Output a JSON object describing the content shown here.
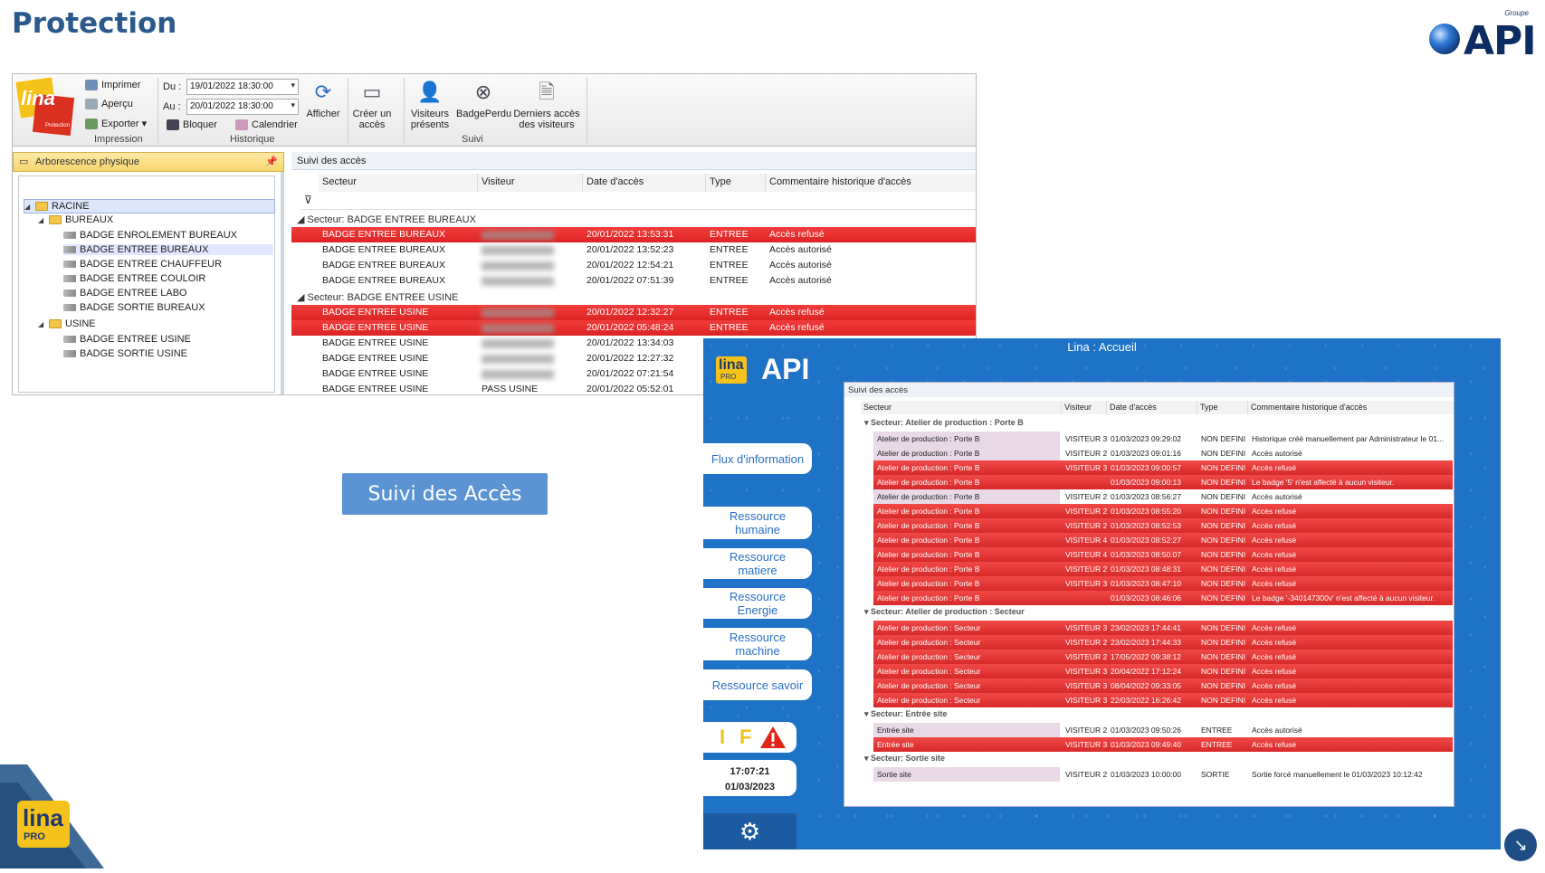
{
  "slide": {
    "title": "Protection",
    "brand_group": "Groupe",
    "brand": "API",
    "center_button": "Suivi des Accès",
    "corner_logo": "lina",
    "corner_logo_sub": "PRO"
  },
  "app1": {
    "ribbon": {
      "print": "Imprimer",
      "preview": "Aperçu",
      "export": "Exporter",
      "group_print": "Impression",
      "from_label": "Du :",
      "from_value": "19/01/2022 18:30:00",
      "to_label": "Au :",
      "to_value": "20/01/2022 18:30:00",
      "block": "Bloquer",
      "calendar": "Calendrier",
      "group_history": "Historique",
      "show": "Afficher",
      "create_access": "Créer un accès",
      "present_visitors": "Visiteurs présents",
      "lost_badge": "BadgePerdu",
      "last_access": "Derniers accès des visiteurs",
      "group_follow": "Suivi",
      "logo": "lina",
      "logo_sub": "Protection"
    },
    "tree": {
      "header": "Arborescence physique",
      "root": "RACINE",
      "folder1": "BUREAUX",
      "folder1_items": [
        "BADGE ENROLEMENT BUREAUX",
        "BADGE ENTREE BUREAUX",
        "BADGE ENTREE CHAUFFEUR",
        "BADGE ENTREE COULOIR",
        "BADGE ENTREE LABO",
        "BADGE SORTIE BUREAUX"
      ],
      "folder2": "USINE",
      "folder2_items": [
        "BADGE ENTREE USINE",
        "BADGE SORTIE USINE"
      ]
    },
    "grid": {
      "header": "Suivi des accès",
      "columns": [
        "Secteur",
        "Visiteur",
        "Date d'accès",
        "Type",
        "Commentaire historique d'accès"
      ],
      "group1": "Secteur: BADGE ENTREE BUREAUX",
      "group1_rows": [
        {
          "sector": "BADGE ENTREE BUREAUX",
          "visitor": "",
          "date": "20/01/2022 13:53:31",
          "type": "ENTREE",
          "comment": "Accès refusé",
          "denied": true
        },
        {
          "sector": "BADGE ENTREE BUREAUX",
          "visitor": "",
          "date": "20/01/2022 13:52:23",
          "type": "ENTREE",
          "comment": "Accès autorisé",
          "denied": false
        },
        {
          "sector": "BADGE ENTREE BUREAUX",
          "visitor": "",
          "date": "20/01/2022 12:54:21",
          "type": "ENTREE",
          "comment": "Accès autorisé",
          "denied": false
        },
        {
          "sector": "BADGE ENTREE BUREAUX",
          "visitor": "",
          "date": "20/01/2022 07:51:39",
          "type": "ENTREE",
          "comment": "Accès autorisé",
          "denied": false
        }
      ],
      "group2": "Secteur: BADGE ENTREE USINE",
      "group2_rows": [
        {
          "sector": "BADGE ENTREE USINE",
          "visitor": "",
          "date": "20/01/2022 12:32:27",
          "type": "ENTREE",
          "comment": "Accès refusé",
          "denied": true
        },
        {
          "sector": "BADGE ENTREE USINE",
          "visitor": "",
          "date": "20/01/2022 05:48:24",
          "type": "ENTREE",
          "comment": "Accès refusé",
          "denied": true
        },
        {
          "sector": "BADGE ENTREE USINE",
          "visitor": "",
          "date": "20/01/2022 13:34:03",
          "type": "",
          "comment": "",
          "denied": false
        },
        {
          "sector": "BADGE ENTREE USINE",
          "visitor": "",
          "date": "20/01/2022 12:27:32",
          "type": "",
          "comment": "",
          "denied": false
        },
        {
          "sector": "BADGE ENTREE USINE",
          "visitor": "",
          "date": "20/01/2022 07:21:54",
          "type": "",
          "comment": "",
          "denied": false
        },
        {
          "sector": "BADGE ENTREE USINE",
          "visitor": "PASS USINE",
          "date": "20/01/2022 05:52:01",
          "type": "",
          "comment": "",
          "denied": false
        }
      ]
    }
  },
  "app2": {
    "title": "Lina : Accueil",
    "logo": "lina",
    "logo_sub": "PRO",
    "logo_brand": "API",
    "menu": [
      "Flux d'information",
      "Ressource humaine",
      "Ressource matiere",
      "Ressource Energie",
      "Ressource machine",
      "Ressource savoir"
    ],
    "alert_letters": [
      "I",
      "F"
    ],
    "time": "17:07:21",
    "date": "01/03/2023",
    "grid_header": "Suivi des accès",
    "columns": [
      "Secteur",
      "Visiteur",
      "Date d'accès",
      "Type",
      "Commentaire historique d'accès"
    ],
    "groups": [
      {
        "label": "Secteur: Atelier de production : Porte B",
        "rows": [
          {
            "s": "Atelier de production : Porte B",
            "v": "VISITEUR 3",
            "d": "01/03/2023 09:29:02",
            "t": "NON DEFINI",
            "c": "Historique créé manuellement par Administrateur le 01...",
            "red": false
          },
          {
            "s": "Atelier de production : Porte B",
            "v": "VISITEUR 2",
            "d": "01/03/2023 09:01:16",
            "t": "NON DEFINI",
            "c": "Accès autorisé",
            "red": false
          },
          {
            "s": "Atelier de production : Porte B",
            "v": "VISITEUR 3",
            "d": "01/03/2023 09:00:57",
            "t": "NON DEFINI",
            "c": "Accès refusé",
            "red": true
          },
          {
            "s": "Atelier de production : Porte B",
            "v": "",
            "d": "01/03/2023 09:00:13",
            "t": "NON DEFINI",
            "c": "Le badge '5' n'est affecté à aucun visiteur.",
            "red": true
          },
          {
            "s": "Atelier de production : Porte B",
            "v": "VISITEUR 2",
            "d": "01/03/2023 08:56:27",
            "t": "NON DEFINI",
            "c": "Accès autorisé",
            "red": false
          },
          {
            "s": "Atelier de production : Porte B",
            "v": "VISITEUR 2",
            "d": "01/03/2023 08:55:20",
            "t": "NON DEFINI",
            "c": "Accès refusé",
            "red": true
          },
          {
            "s": "Atelier de production : Porte B",
            "v": "VISITEUR 2",
            "d": "01/03/2023 08:52:53",
            "t": "NON DEFINI",
            "c": "Accès refusé",
            "red": true
          },
          {
            "s": "Atelier de production : Porte B",
            "v": "VISITEUR 4",
            "d": "01/03/2023 08:52:27",
            "t": "NON DEFINI",
            "c": "Accès refusé",
            "red": true
          },
          {
            "s": "Atelier de production : Porte B",
            "v": "VISITEUR 4",
            "d": "01/03/2023 08:50:07",
            "t": "NON DEFINI",
            "c": "Accès refusé",
            "red": true
          },
          {
            "s": "Atelier de production : Porte B",
            "v": "VISITEUR 2",
            "d": "01/03/2023 08:48:31",
            "t": "NON DEFINI",
            "c": "Accès refusé",
            "red": true
          },
          {
            "s": "Atelier de production : Porte B",
            "v": "VISITEUR 3",
            "d": "01/03/2023 08:47:10",
            "t": "NON DEFINI",
            "c": "Accès refusé",
            "red": true
          },
          {
            "s": "Atelier de production : Porte B",
            "v": "",
            "d": "01/03/2023 08:46:06",
            "t": "NON DEFINI",
            "c": "Le badge '-340147300v' n'est affecté à aucun visiteur.",
            "red": true
          }
        ]
      },
      {
        "label": "Secteur: Atelier de production : Secteur",
        "rows": [
          {
            "s": "Atelier de production : Secteur",
            "v": "VISITEUR 3",
            "d": "23/02/2023 17:44:41",
            "t": "NON DEFINI",
            "c": "Accès refusé",
            "red": true
          },
          {
            "s": "Atelier de production : Secteur",
            "v": "VISITEUR 2",
            "d": "23/02/2023 17:44:33",
            "t": "NON DEFINI",
            "c": "Accès refusé",
            "red": true
          },
          {
            "s": "Atelier de production : Secteur",
            "v": "VISITEUR 2",
            "d": "17/05/2022 09:38:12",
            "t": "NON DEFINI",
            "c": "Accès refusé",
            "red": true
          },
          {
            "s": "Atelier de production : Secteur",
            "v": "VISITEUR 3",
            "d": "20/04/2022 17:12:24",
            "t": "NON DEFINI",
            "c": "Accès refusé",
            "red": true
          },
          {
            "s": "Atelier de production : Secteur",
            "v": "VISITEUR 3",
            "d": "08/04/2022 09:33:05",
            "t": "NON DEFINI",
            "c": "Accès refusé",
            "red": true
          },
          {
            "s": "Atelier de production : Secteur",
            "v": "VISITEUR 3",
            "d": "22/03/2022 16:26:42",
            "t": "NON DEFINI",
            "c": "Accès refusé",
            "red": true
          }
        ]
      },
      {
        "label": "Secteur: Entrée site",
        "rows": [
          {
            "s": "Entrée site",
            "v": "VISITEUR 2",
            "d": "01/03/2023 09:50:26",
            "t": "ENTREE",
            "c": "Accès autorisé",
            "red": false
          },
          {
            "s": "Entrée site",
            "v": "VISITEUR 3",
            "d": "01/03/2023 09:49:40",
            "t": "ENTREE",
            "c": "Accès refusé",
            "red": true
          }
        ]
      },
      {
        "label": "Secteur: Sortie site",
        "rows": [
          {
            "s": "Sortie site",
            "v": "VISITEUR 2",
            "d": "01/03/2023 10:00:00",
            "t": "SORTIE",
            "c": "Sortie forcé manuellement le 01/03/2023 10:12:42",
            "red": false
          }
        ]
      }
    ]
  }
}
